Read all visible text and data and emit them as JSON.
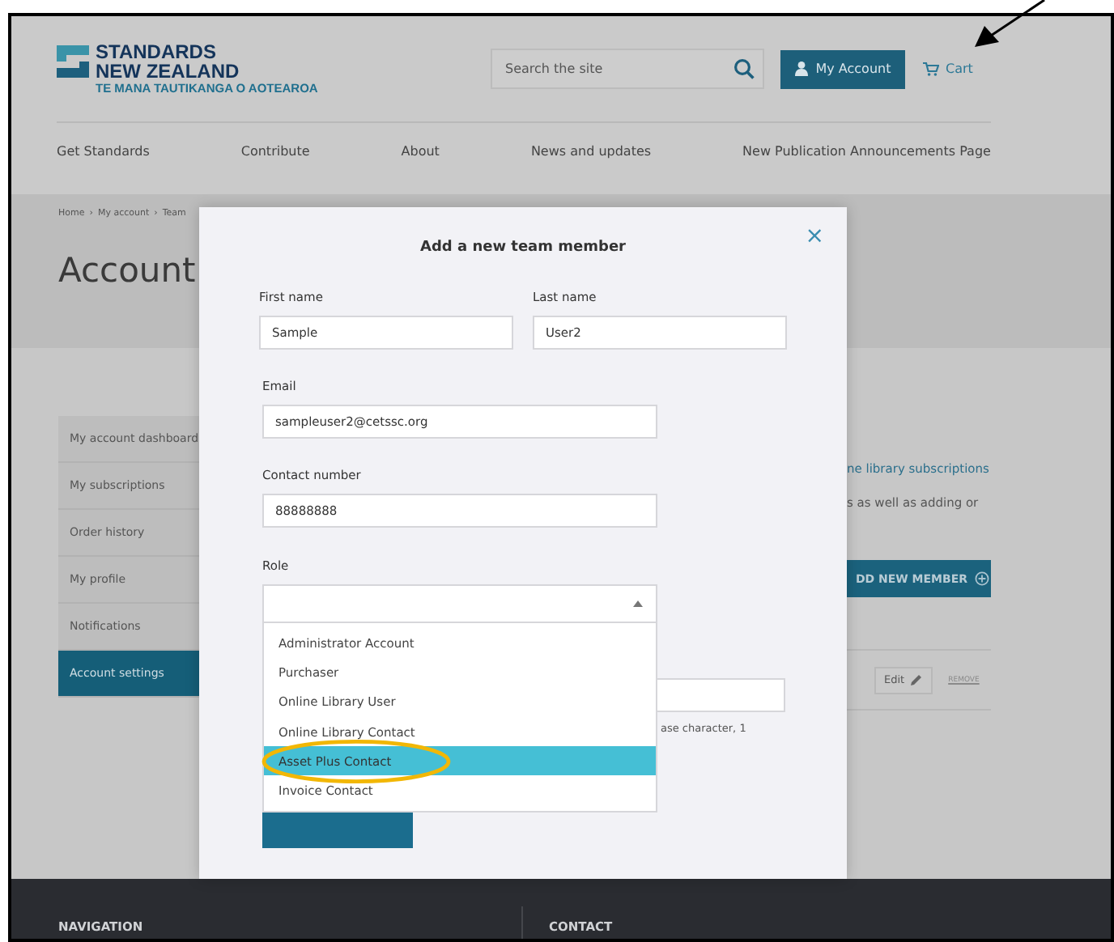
{
  "header": {
    "logo": {
      "line1": "STANDARDS",
      "line2": "NEW ZEALAND",
      "tagline": "TE MANA TAUTIKANGA O AOTEAROA"
    },
    "search": {
      "placeholder": "Search the site"
    },
    "account_button": "My Account",
    "cart": "Cart"
  },
  "nav": [
    "Get Standards",
    "Contribute",
    "About",
    "News and updates",
    "New Publication Announcements Page"
  ],
  "breadcrumb": [
    {
      "label": "Home",
      "separator": "›"
    },
    {
      "label": "My account",
      "separator": "›"
    },
    {
      "label": "Team"
    }
  ],
  "page_title": "Account",
  "sidebar": [
    {
      "label": "My account dashboard",
      "selected": false
    },
    {
      "label": "My subscriptions",
      "selected": false
    },
    {
      "label": "Order history",
      "selected": false
    },
    {
      "label": "My profile",
      "selected": false
    },
    {
      "label": "Notifications",
      "selected": false
    },
    {
      "label": "Account settings",
      "selected": true
    }
  ],
  "content": {
    "link": "ne library subscriptions",
    "text": "s as well as adding or",
    "add_button": "DD NEW MEMBER",
    "edit_button": "Edit",
    "remove_link": "REMOVE"
  },
  "modal": {
    "title": "Add a new team member",
    "close": "×",
    "name_fields": [
      {
        "label": "First name",
        "value": "Sample"
      },
      {
        "label": "Last name",
        "value": "User2"
      }
    ],
    "fields": [
      {
        "label": "Email",
        "value": "sampleuser2@cetssc.org"
      },
      {
        "label": "Contact number",
        "value": "88888888"
      }
    ],
    "role": {
      "label": "Role",
      "options": [
        {
          "label": "Administrator Account",
          "selected": false
        },
        {
          "label": "Purchaser",
          "selected": false
        },
        {
          "label": "Online Library User",
          "selected": false
        },
        {
          "label": "Online Library Contact",
          "selected": false
        },
        {
          "label": "Asset Plus Contact",
          "selected": true
        },
        {
          "label": "Invoice Contact",
          "selected": false
        }
      ]
    },
    "hint": "ase character, 1"
  },
  "footer": [
    "NAVIGATION",
    "CONTACT"
  ]
}
